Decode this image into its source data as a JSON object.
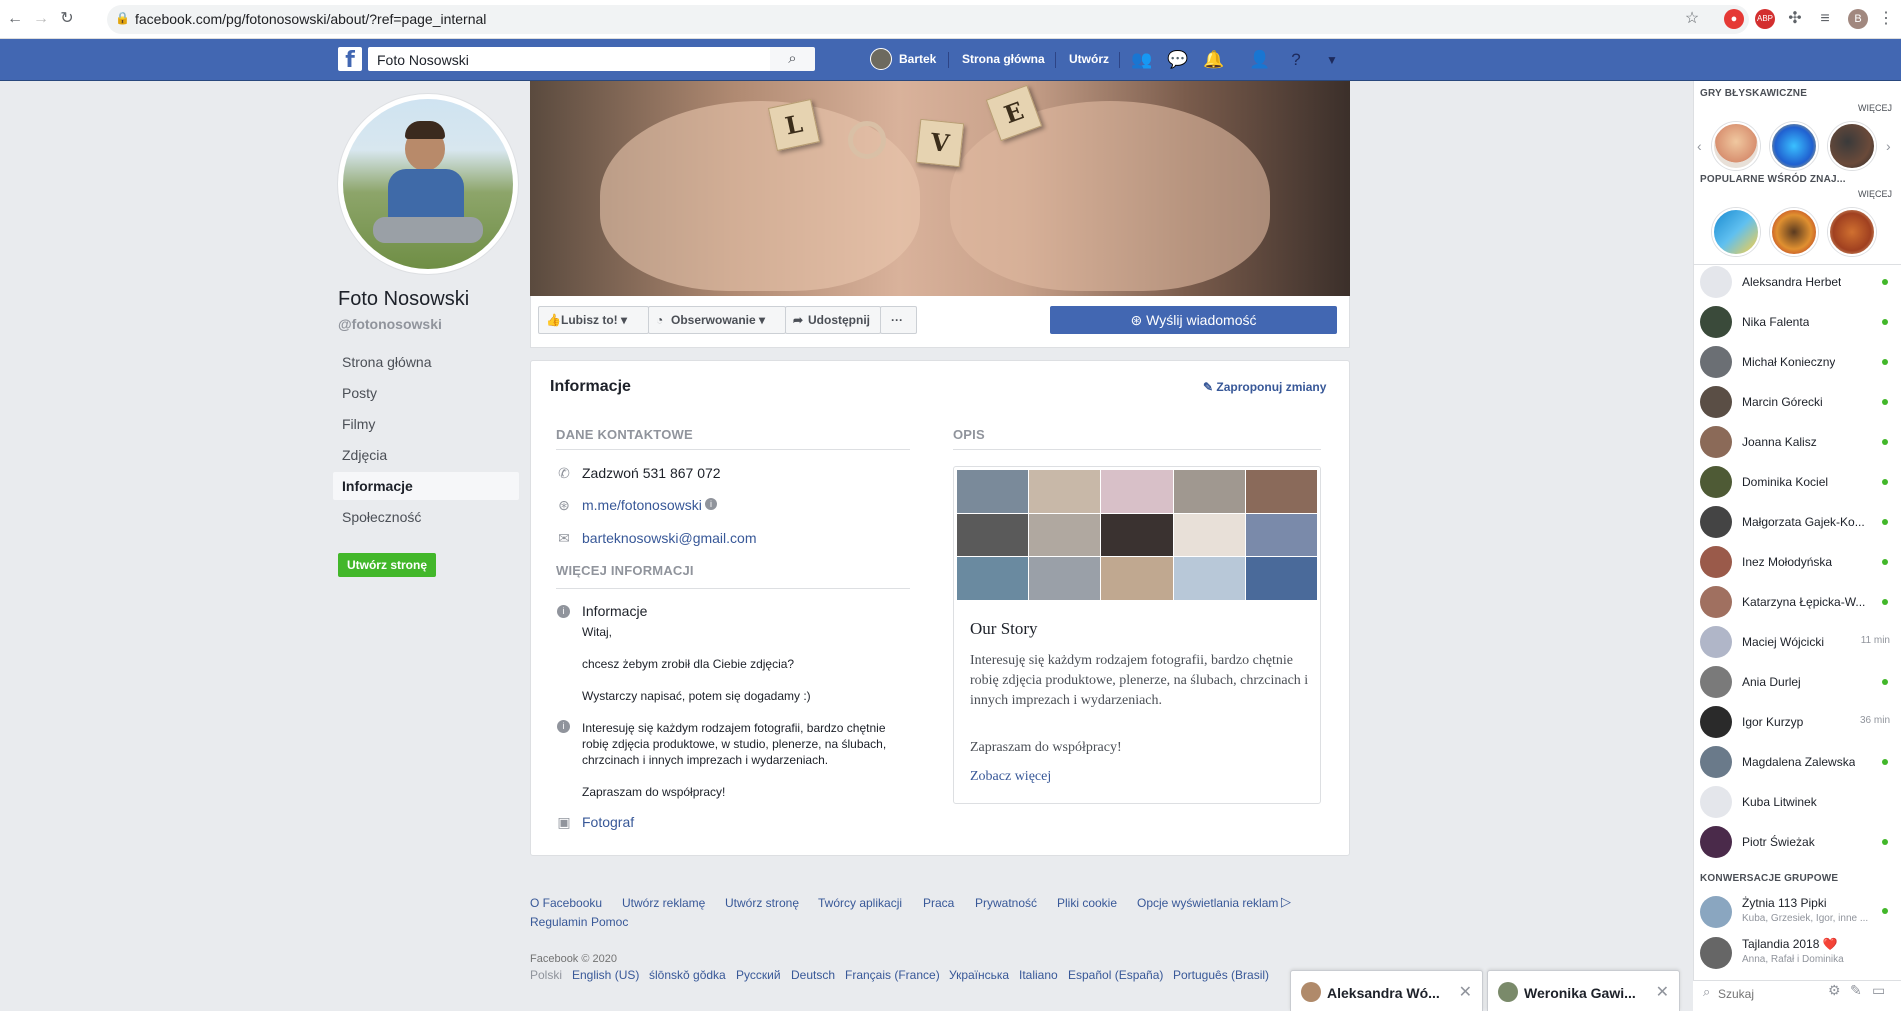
{
  "browser": {
    "url": "facebook.com/pg/fotonosowski/about/?ref=page_internal",
    "profile_initial": "B"
  },
  "fbbar": {
    "logo": "f",
    "search_value": "Foto Nosowski",
    "user": "Bartek",
    "home": "Strona główna",
    "create": "Utwórz"
  },
  "page": {
    "name": "Foto Nosowski",
    "handle": "@fotonosowski",
    "nav": [
      "Strona główna",
      "Posty",
      "Filmy",
      "Zdjęcia",
      "Informacje",
      "Społeczność"
    ],
    "create_page": "Utwórz stronę"
  },
  "cover": {
    "tiles": [
      "L",
      "V",
      "E"
    ]
  },
  "actions": {
    "like": "Lubisz to!",
    "follow": "Obserwowanie",
    "share": "Udostępnij",
    "more": "···",
    "message": "Wyślij wiadomość"
  },
  "info": {
    "title": "Informacje",
    "suggest": "Zaproponuj zmiany",
    "contact_head": "DANE KONTAKTOWE",
    "phone": "Zadzwoń 531 867 072",
    "messenger": "m.me/fotonosowski",
    "email": "barteknosowski@gmail.com",
    "more_head": "WIĘCEJ INFORMACJI",
    "about_label": "Informacje",
    "about_lines": [
      "Witaj,",
      "chcesz żebym zrobił dla Ciebie zdjęcia?",
      "Wystarczy napisać, potem się dogadamy :)"
    ],
    "desc_lines": [
      "Interesuję się każdym rodzajem fotografii, bardzo chętnie",
      "robię zdjęcia produktowe, w studio, plenerze, na ślubach,",
      "chrzcinach i innych imprezach i wydarzeniach."
    ],
    "desc_end": "Zapraszam do współpracy!",
    "category": "Fotograf",
    "opis_head": "OPIS",
    "story_title": "Our Story",
    "story_body": "Interesuję się każdym rodzajem fotografii, bardzo chętnie robię zdjęcia produktowe, plenerze, na ślubach, chrzcinach i innych imprezach i wydarzeniach.",
    "story_end": "Zapraszam do współpracy!",
    "story_more": "Zobacz więcej"
  },
  "footer": {
    "links": [
      "O Facebooku",
      "Utwórz reklamę",
      "Utwórz stronę",
      "Twórcy aplikacji",
      "Praca",
      "Prywatność",
      "Pliki cookie",
      "Opcje wyświetlania reklam"
    ],
    "links2": [
      "Regulamin",
      "Pomoc"
    ],
    "copyright": "Facebook © 2020",
    "languages": [
      "Polski",
      "English (US)",
      "ślōnskŏ gŏdka",
      "Русский",
      "Deutsch",
      "Français (France)",
      "Українська",
      "Italiano",
      "Español (España)",
      "Português (Brasil)"
    ]
  },
  "sidebar": {
    "games_head": "GRY BŁYSKAWICZNE",
    "more1": "WIĘCEJ",
    "popular_head": "POPULARNE WŚRÓD ZNAJ...",
    "more2": "WIĘCEJ",
    "contacts": [
      {
        "name": "Aleksandra Herbet",
        "status": "online",
        "color": "#e4e6eb"
      },
      {
        "name": "Nika Falenta",
        "status": "online",
        "color": "#3a4a3a"
      },
      {
        "name": "Michał Konieczny",
        "status": "online",
        "color": "#6b6f74"
      },
      {
        "name": "Marcin Górecki",
        "status": "online",
        "color": "#5a4e45"
      },
      {
        "name": "Joanna Kalisz",
        "status": "online",
        "color": "#8b6a58"
      },
      {
        "name": "Dominika Kociel",
        "status": "online",
        "color": "#4e5a35"
      },
      {
        "name": "Małgorzata Gajek-Ko...",
        "status": "online",
        "color": "#444"
      },
      {
        "name": "Inez Mołodyńska",
        "status": "online",
        "color": "#9a5a4a"
      },
      {
        "name": "Katarzyna Łępicka-W...",
        "status": "online",
        "color": "#a07060"
      },
      {
        "name": "Maciej Wójcicki",
        "status": "11 min",
        "color": "#b0b6c8"
      },
      {
        "name": "Ania Durlej",
        "status": "online",
        "color": "#7a7a7a"
      },
      {
        "name": "Igor Kurzyp",
        "status": "36 min",
        "color": "#2a2a2a"
      },
      {
        "name": "Magdalena Zalewska",
        "status": "online",
        "color": "#6a7a8a"
      },
      {
        "name": "Kuba Litwinek",
        "status": "",
        "color": "#e4e6eb"
      },
      {
        "name": "Piotr Świeżak",
        "status": "online",
        "color": "#4a2a4a"
      }
    ],
    "groups_head": "KONWERSACJE GRUPOWE",
    "groups": [
      {
        "name": "Żytnia 113 Pipki",
        "members": "Kuba, Grzesiek, Igor, inne ...",
        "color": "#8aa6c0"
      },
      {
        "name": "Tajlandia 2018 ❤️",
        "members": "Anna, Rafał i Dominika",
        "color": "#666"
      }
    ],
    "search_placeholder": "Szukaj"
  },
  "chats": [
    {
      "name": "Aleksandra Wó...",
      "color": "#b08a6a"
    },
    {
      "name": "Weronika Gawi...",
      "color": "#7a8a6a"
    }
  ]
}
